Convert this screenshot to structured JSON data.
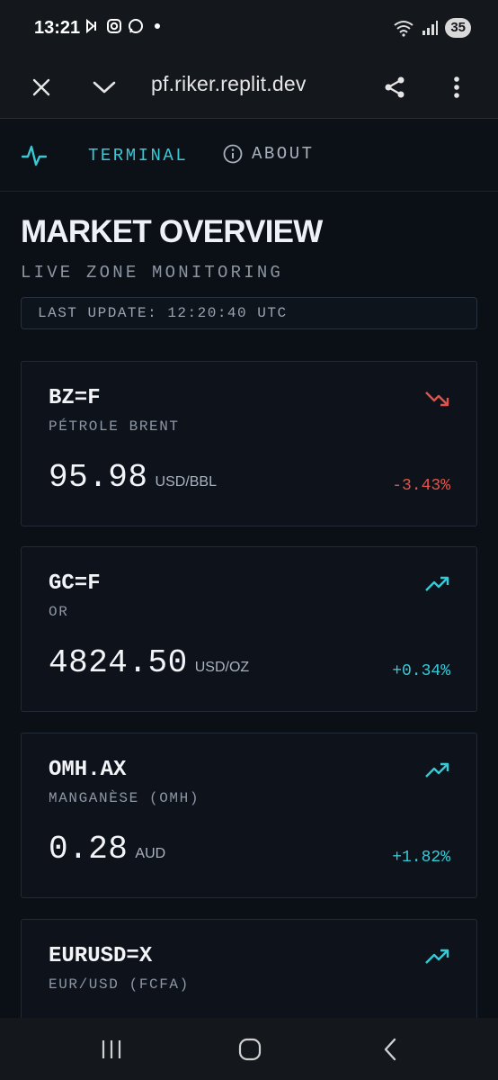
{
  "status_bar": {
    "time": "13:21",
    "battery": "35",
    "icons": [
      "media-icon",
      "instagram-icon",
      "whatsapp-icon",
      "wifi-icon",
      "signal-icon"
    ]
  },
  "browser": {
    "url": "pf.riker.replit.dev",
    "buttons": [
      "close-icon",
      "chevron-down-icon",
      "share-icon",
      "more-vert-icon"
    ]
  },
  "nav": {
    "terminal_label": "TERMINAL",
    "about_label": "ABOUT"
  },
  "header": {
    "title": "MARKET OVERVIEW",
    "subtitle": "LIVE ZONE MONITORING",
    "last_update": "LAST UPDATE: 12:20:40 UTC"
  },
  "colors": {
    "accent": "#36c9d6",
    "negative": "#e0534a",
    "background": "#0b0f16"
  },
  "markets": [
    {
      "ticker": "BZ=F",
      "name": "PÉTROLE BRENT",
      "price": "95.98",
      "unit": "USD/BBL",
      "change": "-3.43%",
      "direction": "down"
    },
    {
      "ticker": "GC=F",
      "name": "OR",
      "price": "4824.50",
      "unit": "USD/OZ",
      "change": "+0.34%",
      "direction": "up"
    },
    {
      "ticker": "OMH.AX",
      "name": "MANGANÈSE (OMH)",
      "price": "0.28",
      "unit": "AUD",
      "change": "+1.82%",
      "direction": "up"
    },
    {
      "ticker": "EURUSD=X",
      "name": "EUR/USD (FCFA)",
      "price": "",
      "unit": "",
      "change": "",
      "direction": "up"
    }
  ]
}
